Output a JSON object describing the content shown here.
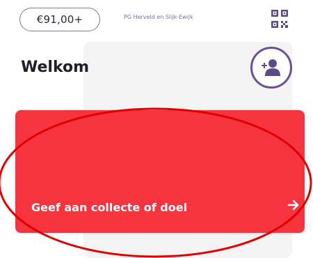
{
  "header": {
    "balance": "€91,00+",
    "organization": "PG Herveld en Slijk-Ewijk",
    "qr_icon": "qr-code-icon"
  },
  "main": {
    "welcome": "Welkom",
    "profile_icon": "add-user-icon",
    "give_card": {
      "label": "Geef aan collecte of doel",
      "arrow_icon": "arrow-right-icon"
    }
  },
  "colors": {
    "accent_red": "#f6343f",
    "brand_purple": "#6a4f99",
    "annotation_red": "#e00000"
  }
}
